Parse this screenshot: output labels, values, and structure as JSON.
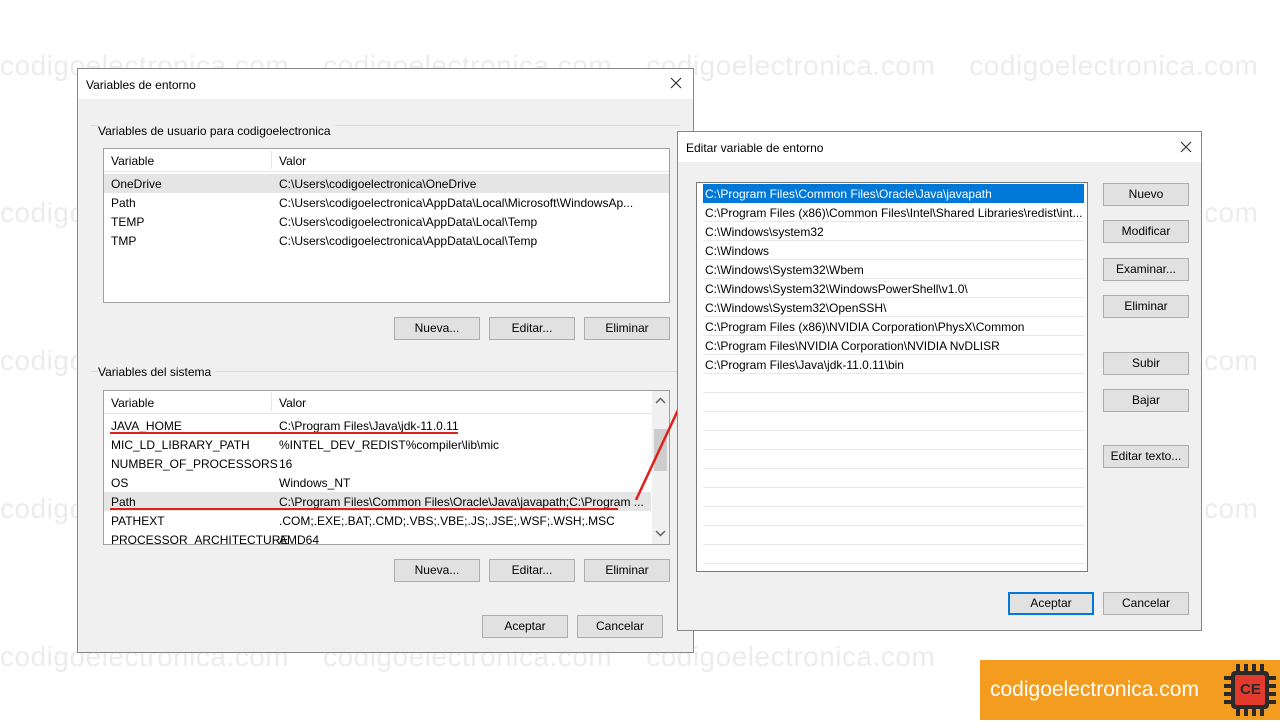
{
  "watermark": "codigoelectronica.com",
  "env_dialog": {
    "title": "Variables de entorno",
    "user_group_label": "Variables de usuario para codigoelectronica",
    "user_headers": [
      "Variable",
      "Valor"
    ],
    "user_rows": [
      {
        "var": "OneDrive",
        "val": "C:\\Users\\codigoelectronica\\OneDrive"
      },
      {
        "var": "Path",
        "val": "C:\\Users\\codigoelectronica\\AppData\\Local\\Microsoft\\WindowsAp..."
      },
      {
        "var": "TEMP",
        "val": "C:\\Users\\codigoelectronica\\AppData\\Local\\Temp"
      },
      {
        "var": "TMP",
        "val": "C:\\Users\\codigoelectronica\\AppData\\Local\\Temp"
      }
    ],
    "user_buttons": {
      "new": "Nueva...",
      "edit": "Editar...",
      "delete": "Eliminar"
    },
    "system_group_label": "Variables del sistema",
    "system_headers": [
      "Variable",
      "Valor"
    ],
    "system_rows": [
      {
        "var": "JAVA_HOME",
        "val": "C:\\Program Files\\Java\\jdk-11.0.11"
      },
      {
        "var": "MIC_LD_LIBRARY_PATH",
        "val": "%INTEL_DEV_REDIST%compiler\\lib\\mic"
      },
      {
        "var": "NUMBER_OF_PROCESSORS",
        "val": "16"
      },
      {
        "var": "OS",
        "val": "Windows_NT"
      },
      {
        "var": "Path",
        "val": "C:\\Program Files\\Common Files\\Oracle\\Java\\javapath;C:\\Program ..."
      },
      {
        "var": "PATHEXT",
        "val": ".COM;.EXE;.BAT;.CMD;.VBS;.VBE;.JS;.JSE;.WSF;.WSH;.MSC"
      },
      {
        "var": "PROCESSOR_ARCHITECTURE",
        "val": "AMD64"
      }
    ],
    "system_buttons": {
      "new": "Nueva...",
      "edit": "Editar...",
      "delete": "Eliminar"
    },
    "ok": "Aceptar",
    "cancel": "Cancelar"
  },
  "edit_dialog": {
    "title": "Editar variable de entorno",
    "paths": [
      "C:\\Program Files\\Common Files\\Oracle\\Java\\javapath",
      "C:\\Program Files (x86)\\Common Files\\Intel\\Shared Libraries\\redist\\int...",
      "C:\\Windows\\system32",
      "C:\\Windows",
      "C:\\Windows\\System32\\Wbem",
      "C:\\Windows\\System32\\WindowsPowerShell\\v1.0\\",
      "C:\\Windows\\System32\\OpenSSH\\",
      "C:\\Program Files (x86)\\NVIDIA Corporation\\PhysX\\Common",
      "C:\\Program Files\\NVIDIA Corporation\\NVIDIA NvDLISR",
      "C:\\Program Files\\Java\\jdk-11.0.11\\bin"
    ],
    "selected_index": 0,
    "buttons": {
      "new": "Nuevo",
      "modify": "Modificar",
      "browse": "Examinar...",
      "delete": "Eliminar",
      "up": "Subir",
      "down": "Bajar",
      "edit_text": "Editar texto..."
    },
    "ok": "Aceptar",
    "cancel": "Cancelar"
  },
  "brand": {
    "text": "codigoelectronica.com",
    "logo_letters": "CE"
  },
  "colors": {
    "accent": "#0078d7",
    "annotation": "#e0201b",
    "brand": "#f39c1f"
  }
}
